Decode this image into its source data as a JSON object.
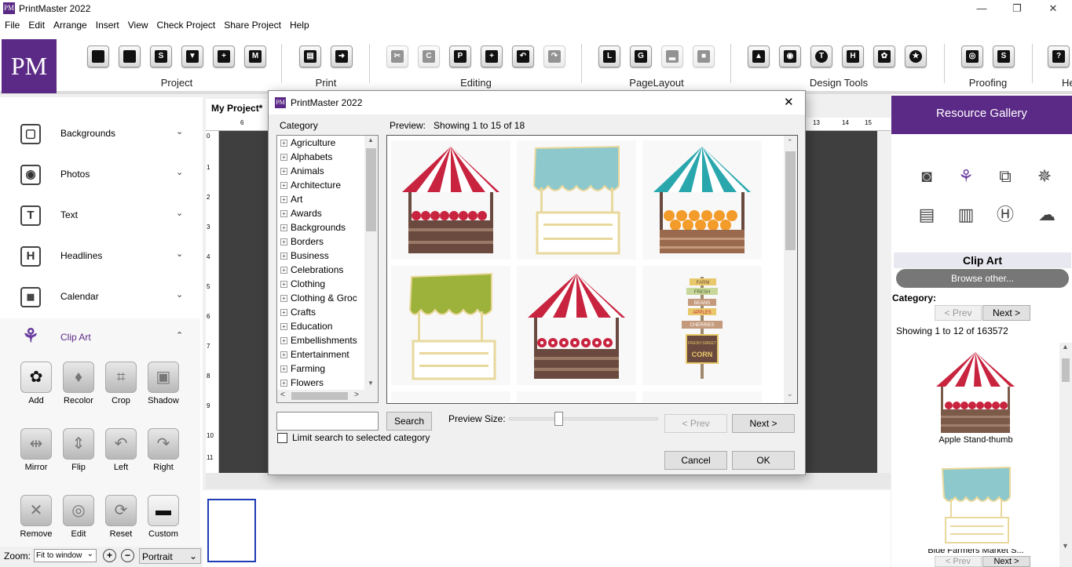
{
  "window": {
    "title": "PrintMaster 2022",
    "logo_text": "PM",
    "minimize": "—",
    "restore": "❐",
    "close": "✕"
  },
  "menu": [
    "File",
    "Edit",
    "Arrange",
    "Insert",
    "View",
    "Check Project",
    "Share Project",
    "Help"
  ],
  "ribbon": {
    "logo_text": "PM",
    "groups": [
      "Project",
      "Print",
      "Editing",
      "PageLayout",
      "Design Tools",
      "Proofing",
      "He"
    ]
  },
  "left_panel": {
    "categories": [
      {
        "label": "Backgrounds",
        "icon": "backgrounds-icon",
        "chevron": "⌄"
      },
      {
        "label": "Photos",
        "icon": "camera-icon",
        "chevron": "⌄"
      },
      {
        "label": "Text",
        "icon": "text-icon",
        "chevron": "⌄"
      },
      {
        "label": "Headlines",
        "icon": "headline-icon",
        "chevron": "⌄"
      },
      {
        "label": "Calendar",
        "icon": "calendar-icon",
        "chevron": "⌄"
      },
      {
        "label": "Clip Art",
        "icon": "lotus-icon",
        "chevron": "⌃"
      }
    ],
    "tools": [
      {
        "label": "Add",
        "icon": "add-clipart-icon",
        "enabled": true
      },
      {
        "label": "Recolor",
        "icon": "recolor-icon",
        "enabled": false
      },
      {
        "label": "Crop",
        "icon": "crop-icon",
        "enabled": false
      },
      {
        "label": "Shadow",
        "icon": "shadow-icon",
        "enabled": false
      },
      {
        "label": "Mirror",
        "icon": "mirror-icon",
        "enabled": false
      },
      {
        "label": "Flip",
        "icon": "flip-icon",
        "enabled": false
      },
      {
        "label": "Left",
        "icon": "rotate-left-icon",
        "enabled": false
      },
      {
        "label": "Right",
        "icon": "rotate-right-icon",
        "enabled": false
      },
      {
        "label": "Remove",
        "icon": "remove-icon",
        "enabled": false
      },
      {
        "label": "Edit",
        "icon": "edit-icon",
        "enabled": false
      },
      {
        "label": "Reset",
        "icon": "reset-icon",
        "enabled": false
      },
      {
        "label": "Custom",
        "icon": "folder-icon",
        "enabled": true
      }
    ]
  },
  "bottom_bar": {
    "zoom_label": "Zoom:",
    "zoom_value": "Fit to window",
    "zoom_in": "+",
    "zoom_out": "−",
    "orientation": "Portrait"
  },
  "workspace": {
    "tab": "My Project*",
    "ruler_top": [
      "6",
      "13",
      "14",
      "15"
    ],
    "ruler_left": [
      "0",
      "1",
      "2",
      "3",
      "4",
      "5",
      "6",
      "7",
      "8",
      "9",
      "10",
      "11"
    ]
  },
  "resource_gallery": {
    "title": "Resource Gallery",
    "section": "Clip Art",
    "browse": "Browse other...",
    "category_label": "Category:",
    "prev": "< Prev",
    "next": "Next >",
    "showing": "Showing 1 to 12 of 163572",
    "items": [
      "Apple Stand-thumb",
      "Blue Farmers Market S..."
    ]
  },
  "dialog": {
    "title": "PrintMaster 2022",
    "logo_text": "PM",
    "close": "✕",
    "category_label": "Category",
    "preview_label": "Preview:",
    "showing": "Showing 1 to 15 of 18",
    "categories": [
      "Agriculture",
      "Alphabets",
      "Animals",
      "Architecture",
      "Art",
      "Awards",
      "Backgrounds",
      "Borders",
      "Business",
      "Celebrations",
      "Clothing",
      "Clothing & Groc",
      "Crafts",
      "Education",
      "Embellishments",
      "Entertainment",
      "Farming",
      "Flowers"
    ],
    "search_button": "Search",
    "search_value": "",
    "limit_label": "Limit search to selected category",
    "preview_size_label": "Preview Size:",
    "prev": "< Prev",
    "next": "Next >",
    "cancel": "Cancel",
    "ok": "OK",
    "preview_size_fraction": 0.33,
    "sign_text": [
      "FARM",
      "FRESH",
      "BEANS",
      "APPLES",
      "CHERRIES",
      "FRESH SWEET",
      "CORN"
    ]
  }
}
